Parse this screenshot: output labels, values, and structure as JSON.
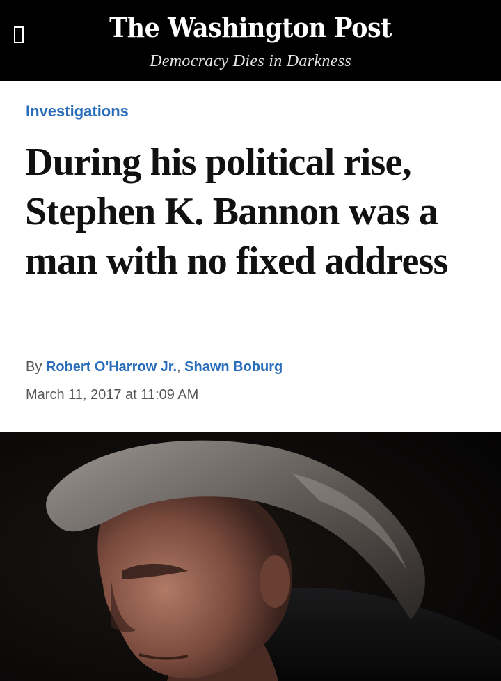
{
  "masthead": {
    "logo": "The Washington Post",
    "tagline": "Democracy Dies in Darkness",
    "menu_icon": "menu-icon"
  },
  "article": {
    "section": "Investigations",
    "headline": "During his political rise, Stephen K. Bannon was a man with no fixed address",
    "byline": {
      "prefix": "By",
      "authors": [
        "Robert O'Harrow Jr.",
        "Shawn Boburg"
      ],
      "separator": ","
    },
    "timestamp": "March 11, 2017 at 11:09 AM"
  },
  "photo": {
    "subject": "portrait-photo"
  },
  "colors": {
    "masthead_bg": "#000000",
    "link_blue": "#2a6ebb",
    "headline": "#111111",
    "meta_gray": "#555555"
  }
}
